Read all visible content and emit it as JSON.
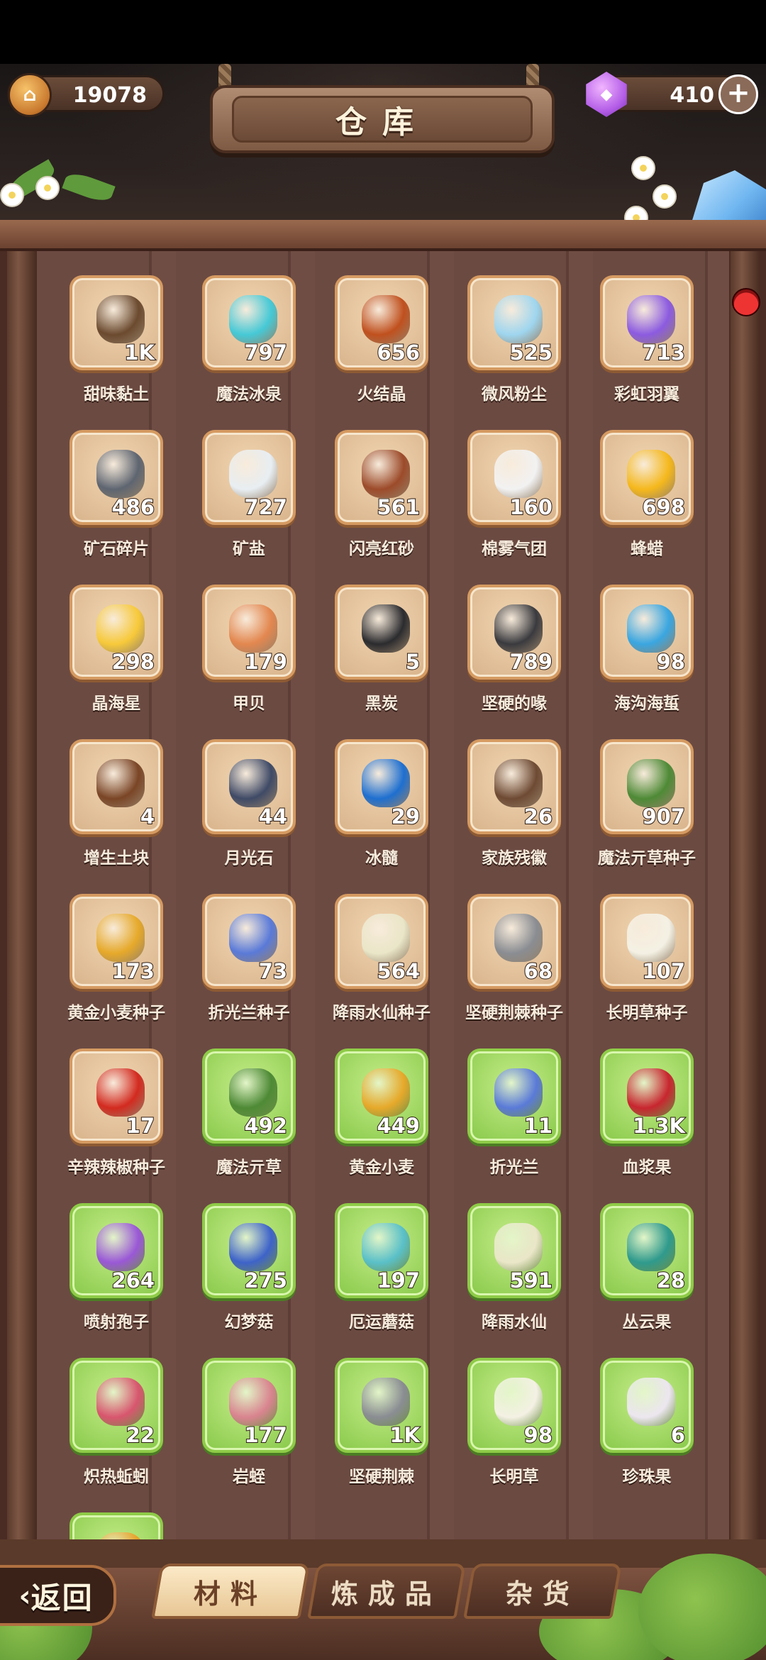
{
  "header": {
    "title": "仓库",
    "coins": "19078",
    "gems": "410",
    "add_label": "+"
  },
  "items": [
    {
      "name": "甜味黏土",
      "count": "1K",
      "rarity": "common",
      "color": "#6b4a2f",
      "icon": "clay-icon"
    },
    {
      "name": "魔法冰泉",
      "count": "797",
      "rarity": "common",
      "color": "#46c9d6",
      "icon": "ice-spring-icon"
    },
    {
      "name": "火结晶",
      "count": "656",
      "rarity": "common",
      "color": "#c0501e",
      "icon": "fire-crystal-icon"
    },
    {
      "name": "微风粉尘",
      "count": "525",
      "rarity": "common",
      "color": "#9fd6ef",
      "icon": "dust-icon"
    },
    {
      "name": "彩虹羽翼",
      "count": "713",
      "rarity": "common",
      "color": "#8c5be0",
      "icon": "rainbow-feather-icon"
    },
    {
      "name": "矿石碎片",
      "count": "486",
      "rarity": "common",
      "color": "#5e6570",
      "icon": "ore-shard-icon"
    },
    {
      "name": "矿盐",
      "count": "727",
      "rarity": "common",
      "color": "#e8eef2",
      "icon": "salt-icon"
    },
    {
      "name": "闪亮红砂",
      "count": "561",
      "rarity": "common",
      "color": "#9c4b2a",
      "icon": "red-sand-icon"
    },
    {
      "name": "棉雾气团",
      "count": "160",
      "rarity": "common",
      "color": "#f2f2f2",
      "icon": "cloud-icon"
    },
    {
      "name": "蜂蜡",
      "count": "698",
      "rarity": "common",
      "color": "#f5b81c",
      "icon": "beeswax-icon"
    },
    {
      "name": "晶海星",
      "count": "298",
      "rarity": "common",
      "color": "#f7c93a",
      "icon": "starfish-icon"
    },
    {
      "name": "甲贝",
      "count": "179",
      "rarity": "common",
      "color": "#e3874f",
      "icon": "shell-icon"
    },
    {
      "name": "黑炭",
      "count": "5",
      "rarity": "common",
      "color": "#2b2b2e",
      "icon": "charcoal-icon"
    },
    {
      "name": "坚硬的喙",
      "count": "789",
      "rarity": "common",
      "color": "#3a3a3e",
      "icon": "beak-icon"
    },
    {
      "name": "海沟海蜇",
      "count": "98",
      "rarity": "common",
      "color": "#3aa6e0",
      "icon": "jellyfish-icon"
    },
    {
      "name": "增生土块",
      "count": "4",
      "rarity": "common",
      "color": "#7a4526",
      "icon": "dirt-icon"
    },
    {
      "name": "月光石",
      "count": "44",
      "rarity": "common",
      "color": "#3f4a66",
      "icon": "moonstone-icon"
    },
    {
      "name": "冰髓",
      "count": "29",
      "rarity": "common",
      "color": "#1e6fd0",
      "icon": "ice-marrow-icon"
    },
    {
      "name": "家族残徽",
      "count": "26",
      "rarity": "common",
      "color": "#6e4a33",
      "icon": "emblem-icon"
    },
    {
      "name": "魔法亓草种子",
      "count": "907",
      "rarity": "common",
      "color": "#4e8a36",
      "icon": "herb-seed-icon"
    },
    {
      "name": "黄金小麦种子",
      "count": "173",
      "rarity": "common",
      "color": "#e6a92a",
      "icon": "wheat-seed-icon"
    },
    {
      "name": "折光兰种子",
      "count": "73",
      "rarity": "common",
      "color": "#5a7ad8",
      "icon": "orchid-seed-icon"
    },
    {
      "name": "降雨水仙种子",
      "count": "564",
      "rarity": "common",
      "color": "#eae6c8",
      "icon": "narcissus-seed-icon"
    },
    {
      "name": "坚硬荆棘种子",
      "count": "68",
      "rarity": "common",
      "color": "#8a8d92",
      "icon": "thorn-seed-icon"
    },
    {
      "name": "长明草种子",
      "count": "107",
      "rarity": "common",
      "color": "#f4f1e4",
      "icon": "daisy-seed-icon"
    },
    {
      "name": "辛辣辣椒种子",
      "count": "17",
      "rarity": "common",
      "color": "#d32a1f",
      "icon": "chili-seed-icon"
    },
    {
      "name": "魔法亓草",
      "count": "492",
      "rarity": "green",
      "color": "#4e8a36",
      "icon": "herb-icon"
    },
    {
      "name": "黄金小麦",
      "count": "449",
      "rarity": "green",
      "color": "#e6a92a",
      "icon": "wheat-icon"
    },
    {
      "name": "折光兰",
      "count": "11",
      "rarity": "green",
      "color": "#5a7ad8",
      "icon": "orchid-icon"
    },
    {
      "name": "血浆果",
      "count": "1.3K",
      "rarity": "green",
      "color": "#c8262f",
      "icon": "blood-berry-icon"
    },
    {
      "name": "喷射孢子",
      "count": "264",
      "rarity": "green",
      "color": "#9a58d6",
      "icon": "spore-icon"
    },
    {
      "name": "幻梦菇",
      "count": "275",
      "rarity": "green",
      "color": "#3e63c9",
      "icon": "dream-mushroom-icon"
    },
    {
      "name": "厄运蘑菇",
      "count": "197",
      "rarity": "green",
      "color": "#5ac0c8",
      "icon": "doom-mushroom-icon"
    },
    {
      "name": "降雨水仙",
      "count": "591",
      "rarity": "green",
      "color": "#eae6c8",
      "icon": "narcissus-icon"
    },
    {
      "name": "丛云果",
      "count": "28",
      "rarity": "green",
      "color": "#2f9a8d",
      "icon": "cloud-fruit-icon"
    },
    {
      "name": "炽热蚯蚓",
      "count": "22",
      "rarity": "green",
      "color": "#d8566e",
      "icon": "worm-icon"
    },
    {
      "name": "岩蛭",
      "count": "177",
      "rarity": "green",
      "color": "#d9848f",
      "icon": "leech-icon"
    },
    {
      "name": "坚硬荆棘",
      "count": "1K",
      "rarity": "green",
      "color": "#8a8d92",
      "icon": "thorn-icon"
    },
    {
      "name": "长明草",
      "count": "98",
      "rarity": "green",
      "color": "#f4f1e4",
      "icon": "daisy-icon"
    },
    {
      "name": "珍珠果",
      "count": "6",
      "rarity": "green",
      "color": "#ece6ef",
      "icon": "pearl-fruit-icon"
    },
    {
      "name": "",
      "count": "",
      "rarity": "green",
      "color": "#e8a32a",
      "icon": "amber-orb-icon"
    }
  ],
  "bottom": {
    "back_label": "返回",
    "tabs": [
      "材料",
      "炼成品",
      "杂货"
    ],
    "active_tab": "材料"
  }
}
